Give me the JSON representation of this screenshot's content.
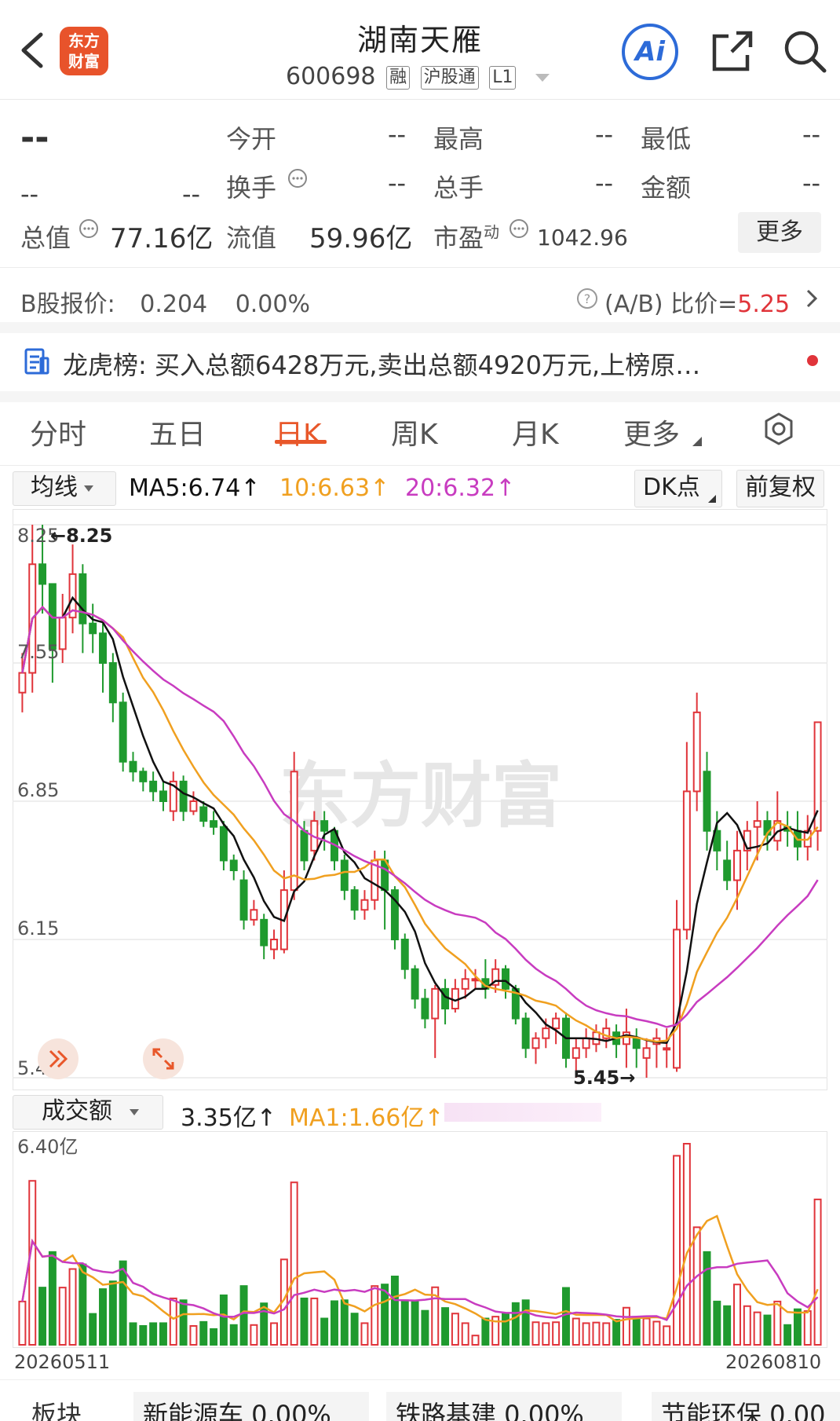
{
  "header": {
    "title": "湖南天雁",
    "code": "600698",
    "tags": [
      "融",
      "沪股通",
      "L1"
    ],
    "logo_lines": [
      "东方",
      "财富"
    ],
    "ai_label": "Ai",
    "icons": [
      "back-arrow-icon",
      "share-icon",
      "search-icon"
    ]
  },
  "quote": {
    "price": "--",
    "change": "--",
    "change_pct": "--",
    "open_label": "今开",
    "open_value": "--",
    "high_label": "最高",
    "high_value": "--",
    "low_label": "最低",
    "low_value": "--",
    "turnover_label": "换手",
    "turnover_value": "--",
    "volume_label": "总手",
    "volume_value": "--",
    "amount_label": "金额",
    "amount_value": "--",
    "mktcap_label": "总值",
    "mktcap_value": "77.16亿",
    "float_label": "流值",
    "float_value": "59.96亿",
    "pe_label": "市盈",
    "pe_sup": "动",
    "pe_value": "1042.96",
    "more_button": "更多"
  },
  "bshare": {
    "label": "B股报价:",
    "price": "0.204",
    "pct": "0.00%",
    "ratio_label": "(A/B) 比价=",
    "ratio_value": "5.25"
  },
  "dragon": {
    "label": "龙虎榜:",
    "text": "买入总额6428万元,卖出总额4920万元,上榜原…"
  },
  "tabs": [
    "分时",
    "五日",
    "日K",
    "周K",
    "月K",
    "更多"
  ],
  "active_tab": "日K",
  "indicator": {
    "selector": "均线",
    "ma5": "MA5:6.74↑",
    "ma10": "10:6.63↑",
    "ma20": "20:6.32↑",
    "dk_button": "DK点",
    "adjust_button": "前复权"
  },
  "kline": {
    "y_labels": [
      "8.25",
      "7.55",
      "6.85",
      "6.15",
      "5.45"
    ],
    "max_marker": "←8.25",
    "min_marker": "5.45→",
    "watermark": "东方财富"
  },
  "volume": {
    "selector": "成交额",
    "value": "3.35亿↑",
    "ma1": "MA1:1.66亿↑",
    "y_max": "6.40亿",
    "start_date": "20260511",
    "end_date": "20260810"
  },
  "colors": {
    "up": "#e0343a",
    "down": "#1f9a2e",
    "ma5": "#111111",
    "ma10": "#f0a020",
    "ma20": "#c83cc0",
    "accent": "#e8572a"
  },
  "chart_data": {
    "type": "candlestick",
    "ylim": [
      5.45,
      8.25
    ],
    "candles": [
      [
        7.4,
        7.5,
        7.6,
        7.3
      ],
      [
        7.5,
        8.05,
        8.25,
        7.4
      ],
      [
        8.05,
        7.95,
        8.25,
        7.8
      ],
      [
        7.95,
        7.62,
        7.9,
        7.45
      ],
      [
        7.62,
        7.78,
        7.9,
        7.55
      ],
      [
        7.78,
        8.0,
        8.15,
        7.7
      ],
      [
        8.0,
        7.75,
        8.05,
        7.6
      ],
      [
        7.75,
        7.7,
        7.85,
        7.6
      ],
      [
        7.7,
        7.55,
        7.75,
        7.4
      ],
      [
        7.55,
        7.35,
        7.6,
        7.25
      ],
      [
        7.35,
        7.05,
        7.4,
        7.0
      ],
      [
        7.05,
        7.0,
        7.1,
        6.95
      ],
      [
        7.0,
        6.95,
        7.02,
        6.9
      ],
      [
        6.95,
        6.9,
        7.0,
        6.85
      ],
      [
        6.9,
        6.85,
        6.95,
        6.8
      ],
      [
        6.8,
        6.95,
        7.0,
        6.75
      ],
      [
        6.95,
        6.8,
        6.98,
        6.75
      ],
      [
        6.8,
        6.85,
        6.9,
        6.78
      ],
      [
        6.82,
        6.75,
        6.85,
        6.72
      ],
      [
        6.75,
        6.72,
        6.8,
        6.68
      ],
      [
        6.72,
        6.55,
        6.75,
        6.5
      ],
      [
        6.55,
        6.5,
        6.58,
        6.45
      ],
      [
        6.45,
        6.25,
        6.5,
        6.2
      ],
      [
        6.25,
        6.3,
        6.35,
        6.22
      ],
      [
        6.25,
        6.12,
        6.28,
        6.05
      ],
      [
        6.1,
        6.15,
        6.2,
        6.05
      ],
      [
        6.1,
        6.4,
        6.5,
        6.08
      ],
      [
        6.4,
        7.0,
        7.1,
        6.35
      ],
      [
        6.7,
        6.55,
        6.75,
        6.5
      ],
      [
        6.6,
        6.75,
        6.8,
        6.55
      ],
      [
        6.75,
        6.7,
        6.8,
        6.6
      ],
      [
        6.7,
        6.55,
        6.72,
        6.5
      ],
      [
        6.55,
        6.4,
        6.58,
        6.35
      ],
      [
        6.4,
        6.3,
        6.42,
        6.25
      ],
      [
        6.3,
        6.35,
        6.4,
        6.25
      ],
      [
        6.35,
        6.55,
        6.6,
        6.3
      ],
      [
        6.55,
        6.4,
        6.6,
        6.2
      ],
      [
        6.4,
        6.15,
        6.42,
        6.1
      ],
      [
        6.15,
        6.0,
        6.18,
        5.95
      ],
      [
        6.0,
        5.85,
        6.02,
        5.8
      ],
      [
        5.85,
        5.75,
        5.9,
        5.7
      ],
      [
        5.75,
        5.9,
        5.92,
        5.55
      ],
      [
        5.9,
        5.8,
        5.95,
        5.72
      ],
      [
        5.8,
        5.9,
        5.95,
        5.78
      ],
      [
        5.9,
        5.95,
        6.0,
        5.85
      ],
      [
        5.95,
        5.95,
        6.0,
        5.9
      ],
      [
        5.95,
        5.9,
        6.05,
        5.85
      ],
      [
        5.92,
        6.0,
        6.05,
        5.88
      ],
      [
        6.0,
        5.9,
        6.02,
        5.85
      ],
      [
        5.9,
        5.75,
        5.92,
        5.72
      ],
      [
        5.75,
        5.6,
        5.78,
        5.55
      ],
      [
        5.6,
        5.65,
        5.68,
        5.52
      ],
      [
        5.65,
        5.7,
        5.75,
        5.6
      ],
      [
        5.7,
        5.75,
        5.78,
        5.62
      ],
      [
        5.75,
        5.55,
        5.78,
        5.5
      ],
      [
        5.55,
        5.6,
        5.65,
        5.45
      ],
      [
        5.6,
        5.65,
        5.7,
        5.55
      ],
      [
        5.62,
        5.68,
        5.72,
        5.58
      ],
      [
        5.65,
        5.7,
        5.75,
        5.6
      ],
      [
        5.68,
        5.62,
        5.72,
        5.55
      ],
      [
        5.62,
        5.68,
        5.8,
        5.5
      ],
      [
        5.65,
        5.6,
        5.7,
        5.5
      ],
      [
        5.55,
        5.6,
        5.65,
        5.45
      ],
      [
        5.62,
        5.65,
        5.7,
        5.5
      ],
      [
        5.6,
        5.6,
        5.7,
        5.5
      ],
      [
        5.5,
        6.2,
        6.35,
        5.48
      ],
      [
        6.2,
        6.9,
        7.15,
        6.15
      ],
      [
        6.9,
        7.3,
        7.4,
        6.8
      ],
      [
        7.0,
        6.7,
        7.1,
        6.6
      ],
      [
        6.7,
        6.6,
        6.8,
        6.5
      ],
      [
        6.55,
        6.45,
        6.65,
        6.4
      ],
      [
        6.45,
        6.6,
        6.7,
        6.3
      ],
      [
        6.6,
        6.7,
        6.75,
        6.5
      ],
      [
        6.72,
        6.75,
        6.85,
        6.55
      ],
      [
        6.75,
        6.68,
        6.8,
        6.6
      ],
      [
        6.65,
        6.75,
        6.9,
        6.6
      ],
      [
        6.72,
        6.7,
        6.8,
        6.62
      ],
      [
        6.7,
        6.62,
        6.8,
        6.55
      ],
      [
        6.62,
        6.7,
        6.78,
        6.55
      ],
      [
        6.7,
        7.25,
        7.25,
        6.6
      ]
    ]
  }
}
